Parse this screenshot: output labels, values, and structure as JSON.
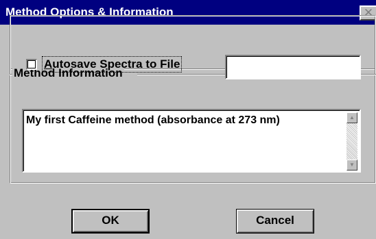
{
  "window": {
    "title": "Method Options & Information",
    "close_symbol": "✕"
  },
  "autosave": {
    "label_first": "A",
    "label_rest": "utosave Spectra to File",
    "checked": false,
    "filename_value": ""
  },
  "method_info": {
    "group_label": "Method Information",
    "text": "My first Caffeine method (absorbance at 273 nm)"
  },
  "buttons": {
    "ok_label": "OK",
    "cancel_label": "Cancel"
  },
  "icons": {
    "scroll_up": "scroll-up-arrow-icon",
    "scroll_down": "scroll-down-arrow-icon",
    "close": "close-icon"
  },
  "colors": {
    "titlebar": "#000080",
    "face": "#c0c0c0"
  }
}
